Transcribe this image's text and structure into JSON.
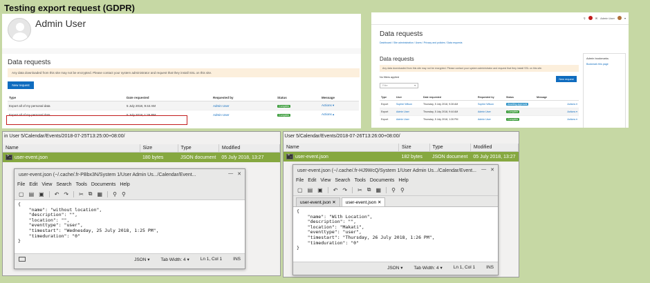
{
  "caption": "Testing export request (GDPR)",
  "left_page": {
    "user_name": "Admin User",
    "section_title": "Data requests",
    "notice": "Any data downloaded from this site may not be encrypted. Please contact your system administrator and request that they install SSL on this site.",
    "new_request": "New request",
    "columns": [
      "Type",
      "Date requested",
      "Requested by",
      "Status",
      "Message"
    ],
    "rows": [
      {
        "type": "Export all of my personal data",
        "date": "5 July 2018, 9:44 AM",
        "by": "Admin User",
        "status": "Complete",
        "actions": "Actions"
      },
      {
        "type": "Export all of my personal data",
        "date": "5 July 2018, 1:26 PM",
        "by": "Admin User",
        "status": "Complete",
        "actions": "Actions"
      }
    ]
  },
  "right_page": {
    "topnav_user": "Admin User",
    "page_title": "Data requests",
    "breadcrumb": "Dashboard / Site administration / Users / Privacy and policies / Data requests",
    "section_title": "Data requests",
    "notice": "Any data downloaded from this site may not be encrypted. Please contact your system administrator and request that they install SSL on this site.",
    "filters": "No filters applied",
    "filter_placeholder": "Filter",
    "new_request": "New request",
    "bookmarks_title": "Admin bookmarks",
    "bookmark_link": "Bookmark this page",
    "columns": [
      "Type",
      "User",
      "Date requested",
      "Requested by",
      "Status",
      "Message"
    ],
    "rows": [
      {
        "type": "Export",
        "user": "Sophie Wilson",
        "date": "Thursday, 5 July 2018, 9:28 AM",
        "by": "Sophie Wilson",
        "status": "Awaiting approval",
        "actions": "Actions"
      },
      {
        "type": "Export",
        "user": "Admin User",
        "date": "Thursday, 5 July 2018, 9:44 AM",
        "by": "Admin User",
        "status": "Complete",
        "actions": "Actions"
      },
      {
        "type": "Export",
        "user": "Admin User",
        "date": "Thursday, 5 July 2018, 1:26 PM",
        "by": "Admin User",
        "status": "Complete",
        "actions": "Actions"
      }
    ]
  },
  "fm_left": {
    "path": "in User 5/Calendar/Events/2018-07-25T13:25:00+08:00/",
    "columns": [
      "Name",
      "Size",
      "Type",
      "Modified"
    ],
    "file": {
      "name": "user-event.json",
      "size": "180 bytes",
      "type": "JSON document",
      "modified": "05 July 2018, 13:27"
    }
  },
  "fm_right": {
    "path": "in User 5/Calendar/Events/2018-07-26T13:26:00+08:00/",
    "columns": [
      "Name",
      "Size",
      "Type",
      "Modified"
    ],
    "file": {
      "name": "user-event.json",
      "size": "182 bytes",
      "type": "JSON document",
      "modified": "05 July 2018, 13:27"
    }
  },
  "editor_left": {
    "title": "user-event.json (~/.cache/.fr-PBbx3N/System 1/User Admin Us.../Calendar/Event...",
    "menu": [
      "File",
      "Edit",
      "View",
      "Search",
      "Tools",
      "Documents",
      "Help"
    ],
    "code": "{\n    \"name\": \"without location\",\n    \"description\": \"\",\n    \"location\": \"\",\n    \"eventtype\": \"user\",\n    \"timestart\": \"Wednesday, 25 July 2018, 1:25 PM\",\n    \"timeduration\": \"0\"\n}",
    "lang": "JSON",
    "tabwidth": "Tab Width: 4",
    "position": "Ln 1, Col 1",
    "mode": "INS"
  },
  "editor_right": {
    "title": "user-event.json (~/.cache/.fr-HJ9WcQ/System 1/User Admin Us.../Calendar/Event...",
    "menu": [
      "File",
      "Edit",
      "View",
      "Search",
      "Tools",
      "Documents",
      "Help"
    ],
    "tabs": [
      "user-event.json",
      "user-event.json"
    ],
    "code": "{\n    \"name\": \"With Location\",\n    \"description\": \"\",\n    \"location\": \"Makati\",\n    \"eventtype\": \"user\",\n    \"timestart\": \"Thursday, 26 July 2018, 1:26 PM\",\n    \"timeduration\": \"0\"\n}",
    "lang": "JSON",
    "tabwidth": "Tab Width: 4",
    "position": "Ln 1, Col 1",
    "mode": "INS"
  }
}
